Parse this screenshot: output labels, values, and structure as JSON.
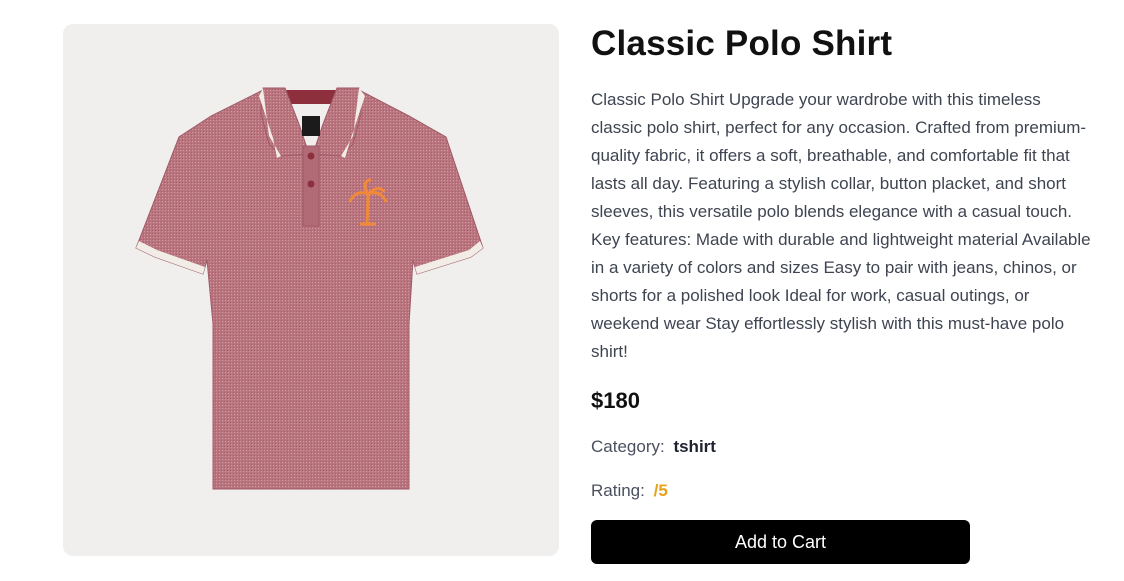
{
  "product": {
    "title": "Classic Polo Shirt",
    "description": "Classic Polo Shirt Upgrade your wardrobe with this timeless classic polo shirt, perfect for any occasion. Crafted from premium-quality fabric, it offers a soft, breathable, and comfortable fit that lasts all day. Featuring a stylish collar, button placket, and short sleeves, this versatile polo blends elegance with a casual touch. Key features: Made with durable and lightweight material Available in a variety of colors and sizes Easy to pair with jeans, chinos, or shorts for a polished look Ideal for work, casual outings, or weekend wear Stay effortlessly stylish with this must-have polo shirt!",
    "price": "$180",
    "category_label": "Category:",
    "category_value": "tshirt",
    "rating_label": "Rating:",
    "rating_value": "/5",
    "add_to_cart_label": "Add to Cart"
  },
  "colors": {
    "shirt": "#b9747e",
    "collar_trim": "#f1ece6",
    "image_bg": "#f0efed",
    "rating_accent": "#e8a21a",
    "button_bg": "#000000"
  },
  "icons": {
    "logo_embroidery": "palm-tree-icon"
  }
}
